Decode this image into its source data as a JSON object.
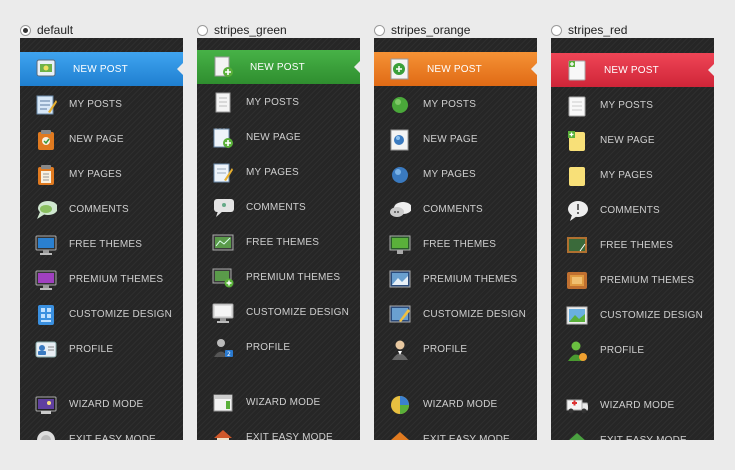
{
  "themes": [
    {
      "id": "default",
      "label": "default",
      "checked": true,
      "accent": "#2a8fe0"
    },
    {
      "id": "stripes_green",
      "label": "stripes_green",
      "checked": false,
      "accent": "#3aa03a"
    },
    {
      "id": "stripes_orange",
      "label": "stripes_orange",
      "checked": false,
      "accent": "#ee7f22"
    },
    {
      "id": "stripes_red",
      "label": "stripes_red",
      "checked": false,
      "accent": "#de3446"
    }
  ],
  "menu": {
    "new_post": "NEW POST",
    "my_posts": "MY POSTS",
    "new_page": "NEW PAGE",
    "my_pages": "MY PAGES",
    "comments": "COMMENTS",
    "free_themes": "FREE THEMES",
    "premium_themes": "PREMIUM THEMES",
    "customize_design": "CUSTOMIZE DESIGN",
    "profile": "PROFILE",
    "wizard_mode": "WIZARD MODE",
    "exit_easy_mode": "EXIT EASY MODE"
  },
  "icons": {
    "default": [
      "new-post-icon",
      "edit-posts-icon",
      "new-page-icon",
      "clipboard-pages-icon",
      "speech-bubble-icon",
      "monitor-icon",
      "premium-monitor-icon",
      "customize-grid-icon",
      "profile-card-icon",
      "wizard-screen-icon",
      "exit-icon"
    ],
    "stripes_green": [
      "add-document-icon",
      "document-icon",
      "add-notepad-icon",
      "notepad-icon",
      "speech-bubble-icon",
      "chart-screen-icon",
      "add-screen-icon",
      "monitor-icon",
      "user-badge-icon",
      "calendar-icon",
      "home-icon"
    ],
    "stripes_orange": [
      "globe-add-icon",
      "globe-document-icon",
      "globe-page-icon",
      "globe-pages-icon",
      "chat-bubbles-icon",
      "green-screen-icon",
      "photo-screen-icon",
      "edit-screen-icon",
      "user-icon",
      "pie-chart-icon",
      "home-icon"
    ],
    "stripes_red": [
      "add-document-icon",
      "document-icon",
      "add-note-icon",
      "note-icon",
      "alert-bubble-icon",
      "chalkboard-icon",
      "frame-icon",
      "landscape-frame-icon",
      "user-add-icon",
      "ambulance-icon",
      "home-icon"
    ]
  }
}
